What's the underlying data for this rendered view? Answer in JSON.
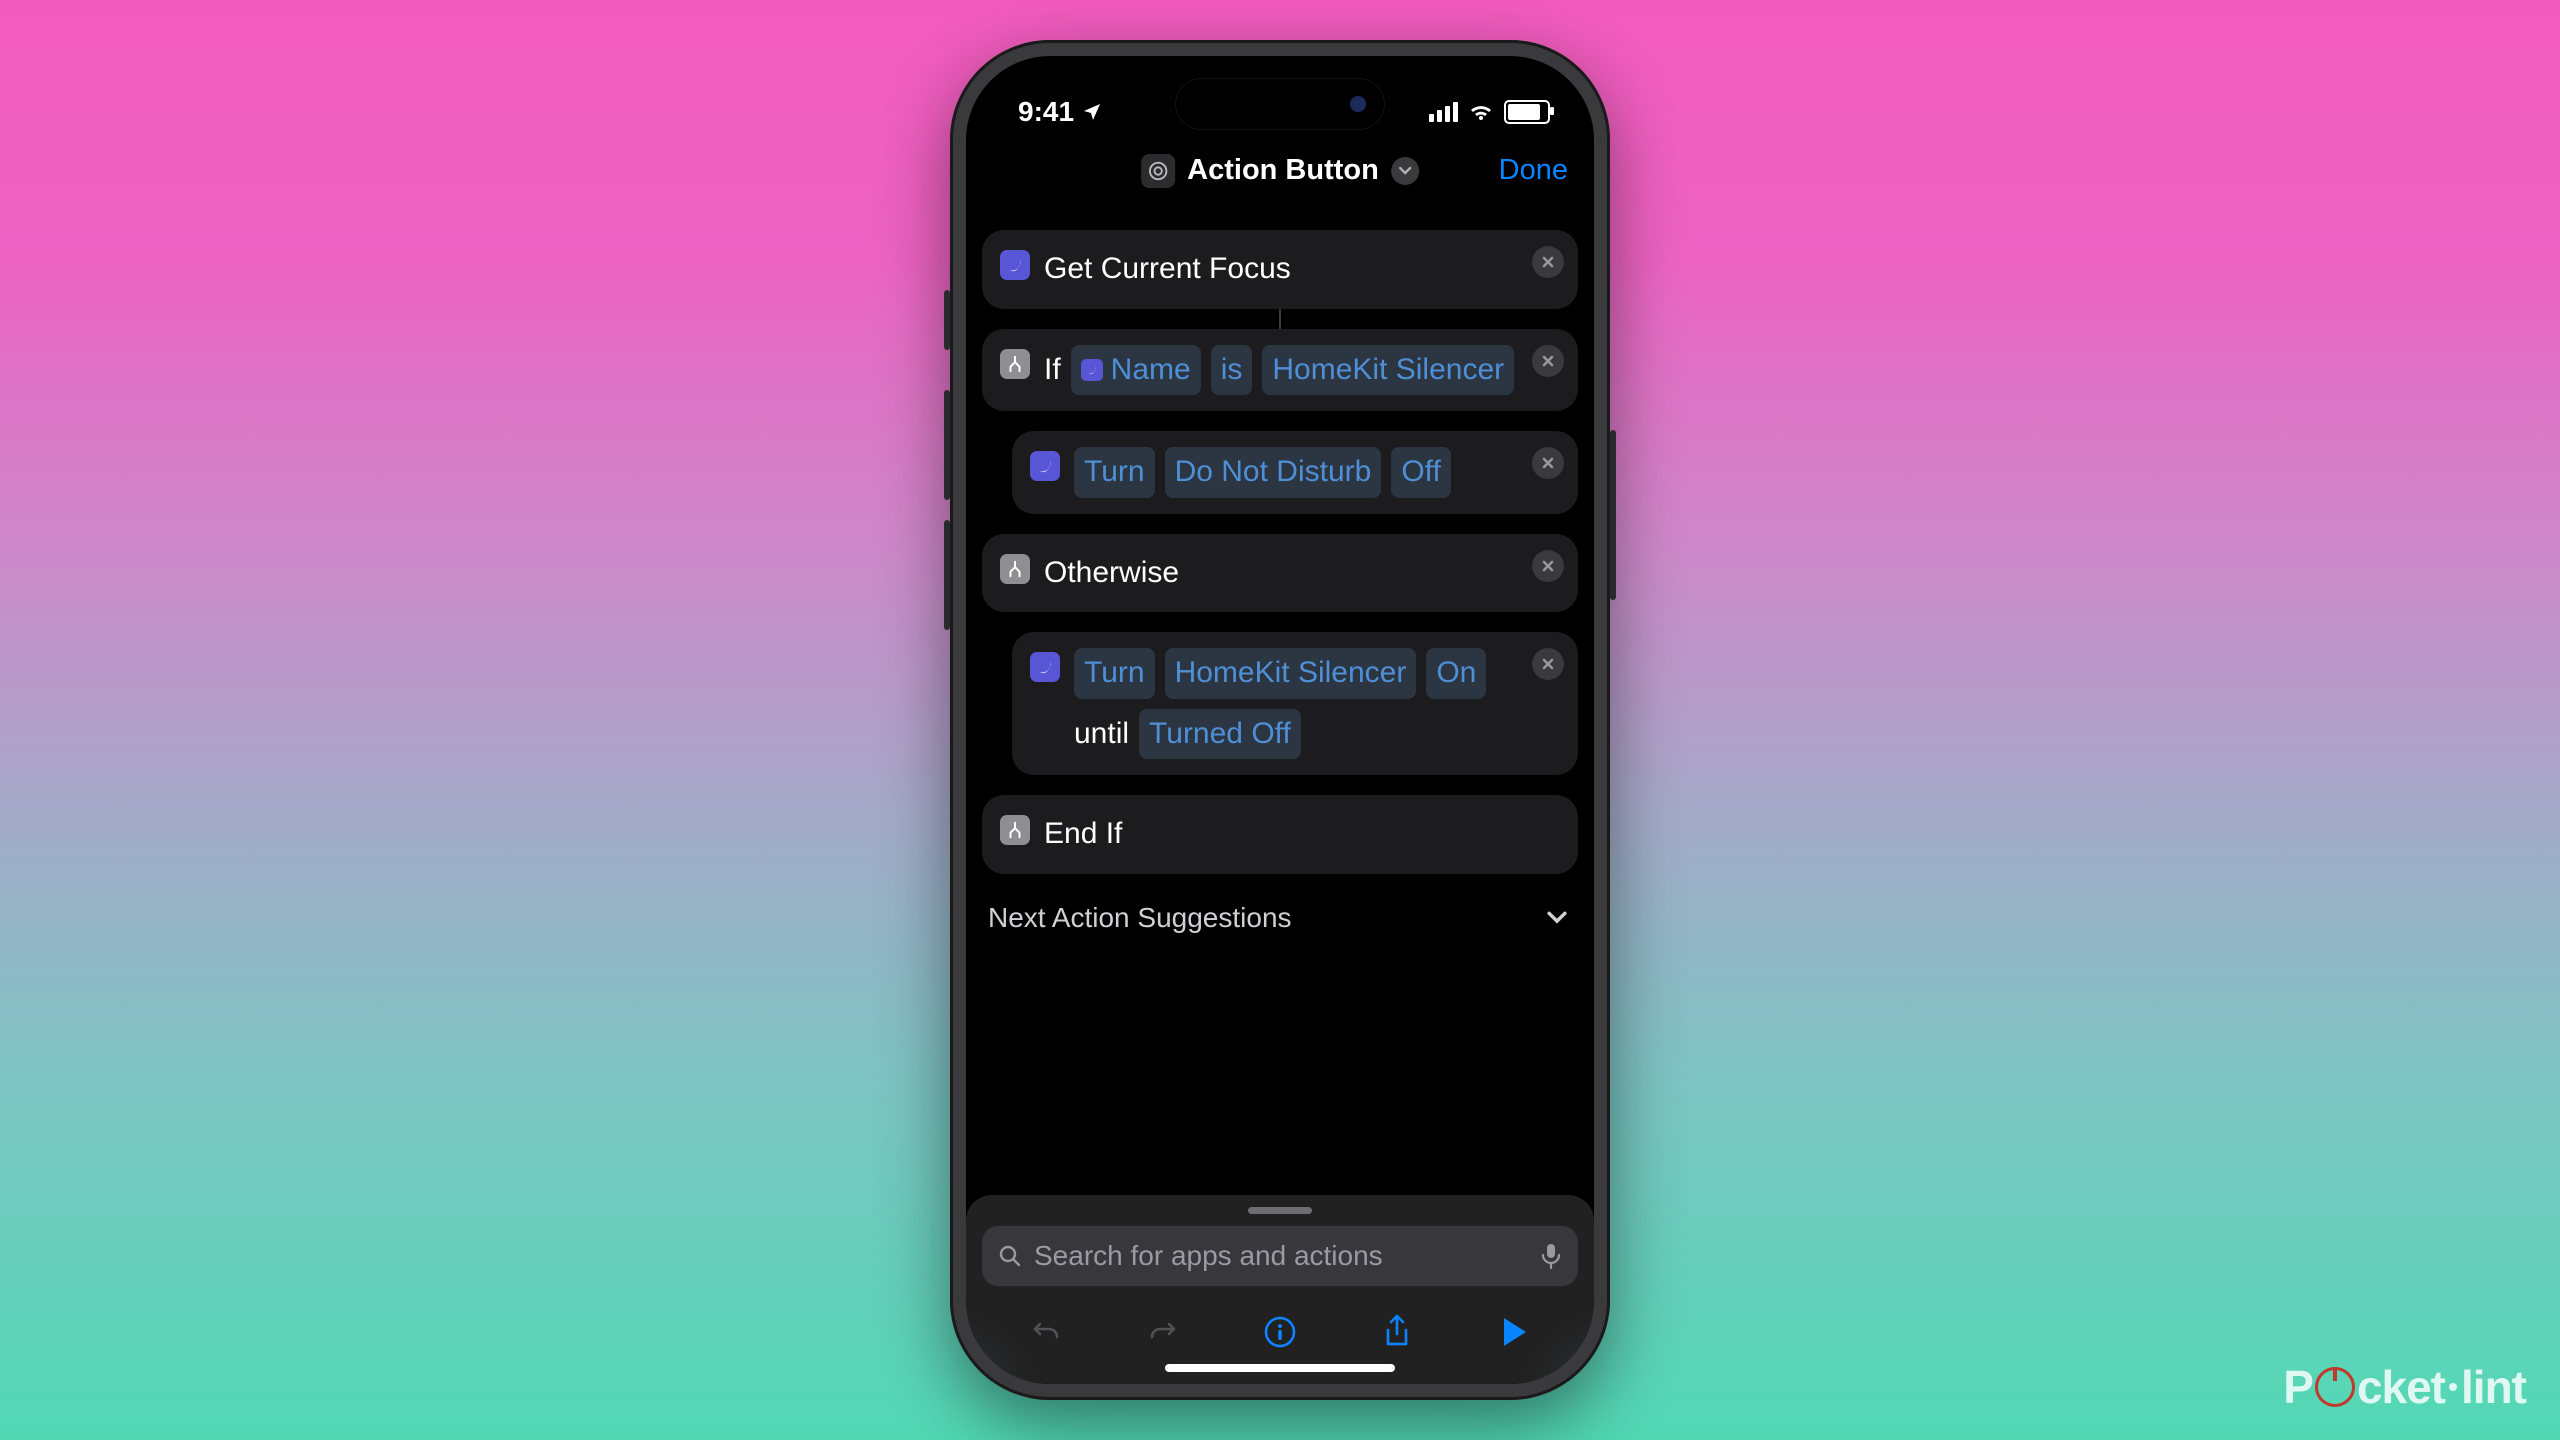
{
  "status": {
    "time": "9:41"
  },
  "header": {
    "title": "Action Button",
    "done": "Done"
  },
  "actions": {
    "getFocus": "Get Current Focus",
    "if": {
      "keyword": "If",
      "varName": "Name",
      "op": "is",
      "value": "HomeKit Silencer"
    },
    "turn1": {
      "verb": "Turn",
      "focus": "Do Not Disturb",
      "state": "Off"
    },
    "otherwise": "Otherwise",
    "turn2": {
      "verb": "Turn",
      "focus": "HomeKit Silencer",
      "state": "On",
      "until_kw": "until",
      "until_val": "Turned Off"
    },
    "endIf": "End If"
  },
  "suggestions_label": "Next Action Suggestions",
  "search": {
    "placeholder": "Search for apps and actions"
  },
  "watermark": {
    "a": "P",
    "b": "cket",
    "c": "lint"
  }
}
